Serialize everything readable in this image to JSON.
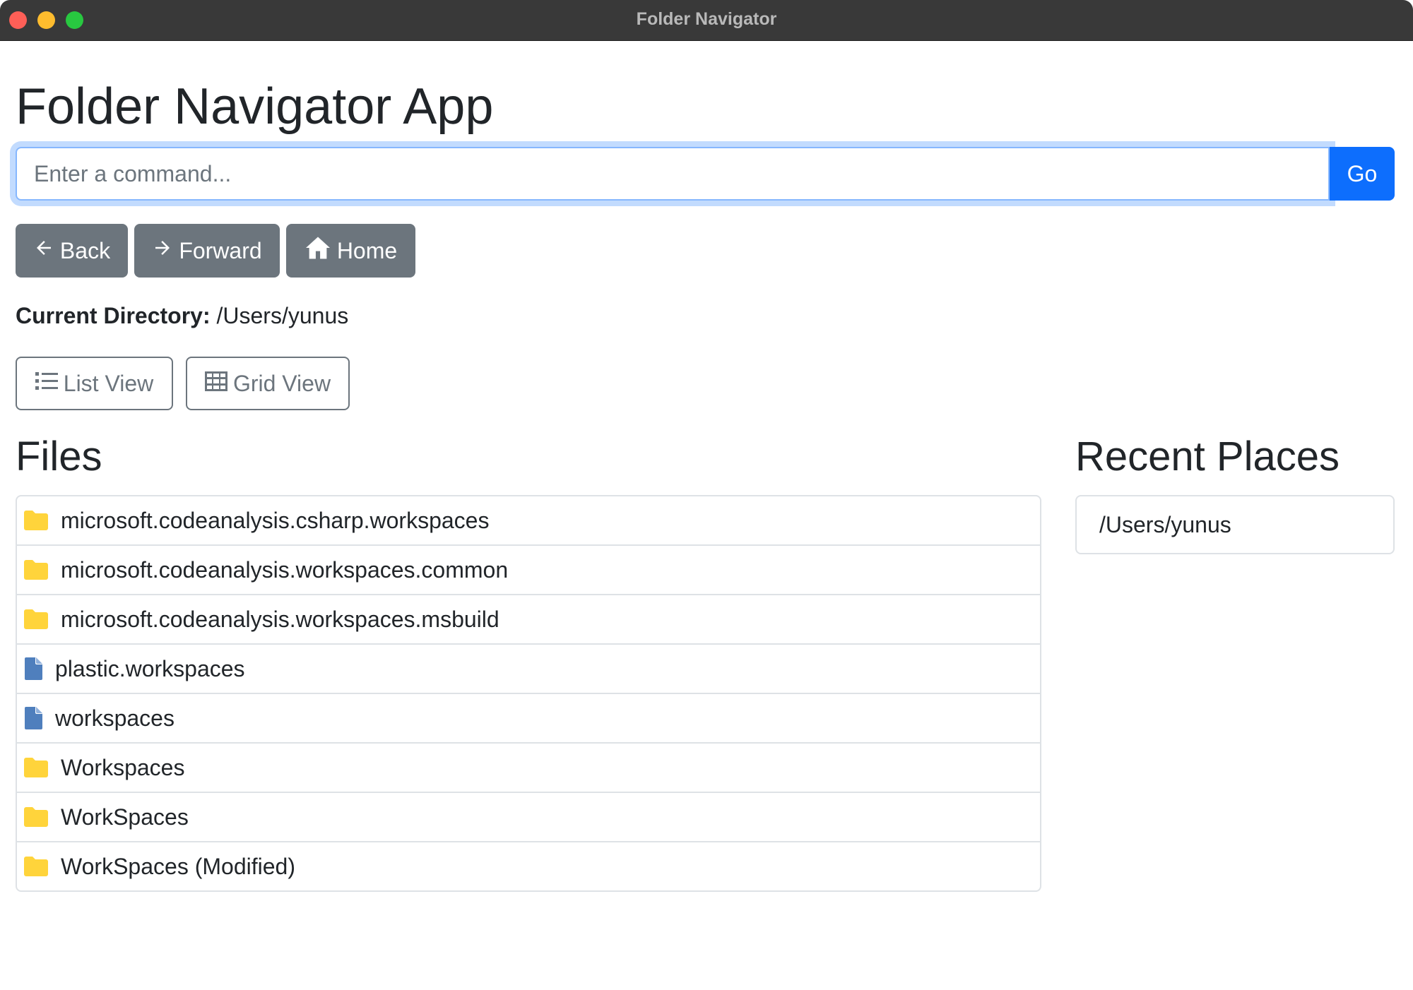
{
  "window": {
    "title": "Folder Navigator"
  },
  "app": {
    "title": "Folder Navigator App"
  },
  "command": {
    "placeholder": "Enter a command...",
    "value": "",
    "go_label": "Go"
  },
  "nav": {
    "back_label": "Back",
    "forward_label": "Forward",
    "home_label": "Home"
  },
  "current_directory": {
    "label": "Current Directory:",
    "path": "/Users/yunus"
  },
  "views": {
    "list_label": "List View",
    "grid_label": "Grid View"
  },
  "files": {
    "title": "Files",
    "items": [
      {
        "name": "microsoft.codeanalysis.csharp.workspaces",
        "type": "folder",
        "icon": "folder-icon"
      },
      {
        "name": "microsoft.codeanalysis.workspaces.common",
        "type": "folder",
        "icon": "folder-icon"
      },
      {
        "name": "microsoft.codeanalysis.workspaces.msbuild",
        "type": "folder",
        "icon": "folder-icon"
      },
      {
        "name": "plastic.workspaces",
        "type": "file",
        "icon": "file-icon"
      },
      {
        "name": "workspaces",
        "type": "file",
        "icon": "file-icon"
      },
      {
        "name": "Workspaces",
        "type": "folder",
        "icon": "folder-icon"
      },
      {
        "name": "WorkSpaces",
        "type": "folder",
        "icon": "folder-icon"
      },
      {
        "name": "WorkSpaces (Modified)",
        "type": "folder",
        "icon": "folder-icon"
      }
    ]
  },
  "recent": {
    "title": "Recent Places",
    "items": [
      {
        "path": "/Users/yunus"
      }
    ]
  },
  "colors": {
    "primary": "#0d6efd",
    "secondary": "#6c757d",
    "folder": "#ffd43b",
    "file": "#4f7fbd",
    "titlebar": "#393939"
  }
}
